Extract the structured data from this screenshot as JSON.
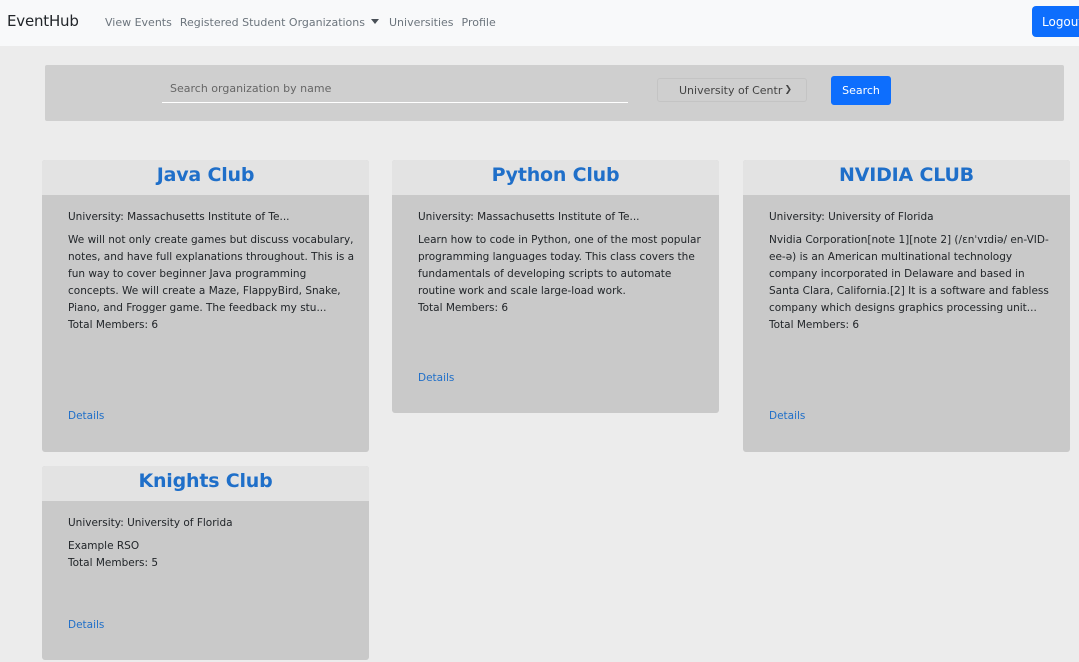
{
  "navbar": {
    "brand": "EventHub",
    "links": [
      "View Events",
      "Registered Student Organizations",
      "Universities",
      "Profile"
    ],
    "logout_label": "Logout"
  },
  "search": {
    "placeholder": "Search organization by name",
    "university_selected": "University of Centr",
    "button_label": "Search"
  },
  "cards": [
    {
      "title": "Java Club",
      "university": "University: Massachusetts Institute of Te...",
      "description": "We will not only create games but discuss vocabulary, notes, and have full explanations throughout. This is a fun way to cover beginner Java programming concepts. We will create a Maze, FlappyBird, Snake, Piano, and Frogger game. The feedback my stu...",
      "members": "Total Members: 6",
      "details_label": "Details"
    },
    {
      "title": "Python Club",
      "university": "University: Massachusetts Institute of Te...",
      "description": "Learn how to code in Python, one of the most popular programming languages today. This class covers the fundamentals of developing scripts to automate routine work and scale large-load work.",
      "members": "Total Members: 6",
      "details_label": "Details"
    },
    {
      "title": "NVIDIA CLUB",
      "university": "University: University of Florida",
      "description": "Nvidia Corporation[note 1][note 2] (/ɛnˈvɪdiə/ en-VID-ee-ə) is an American multinational technology company incorporated in Delaware and based in Santa Clara, California.[2] It is a software and fabless company which designs graphics processing unit...",
      "members": "Total Members: 6",
      "details_label": "Details"
    },
    {
      "title": "Knights Club",
      "university": "University: University of Florida",
      "description": "Example RSO",
      "members": "Total Members: 5",
      "details_label": "Details"
    }
  ]
}
